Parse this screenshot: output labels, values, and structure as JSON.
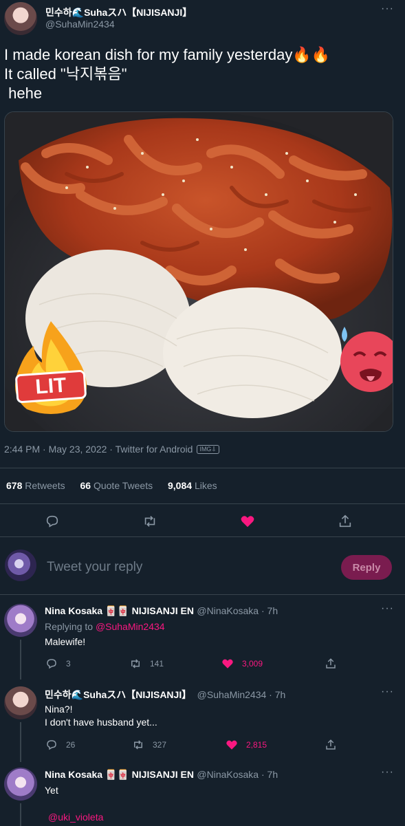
{
  "tweet": {
    "author_name": "민수하🌊Suhaスハ【NIJISANJI】",
    "author_handle": "@SuhaMin2434",
    "text_line1": "I made korean dish for my family yesterday🔥🔥",
    "text_line2": "It called \"낙지볶음\"",
    "text_line3": " hehe",
    "sticker_lit": "LIT",
    "timestamp": "2:44 PM · May 23, 2022 · Twitter for Android",
    "img_tag": "IMG⇩",
    "stats": {
      "retweets_count": "678",
      "retweets_label": "Retweets",
      "quotes_count": "66",
      "quotes_label": "Quote Tweets",
      "likes_count": "9,084",
      "likes_label": "Likes"
    }
  },
  "reply_box": {
    "placeholder": "Tweet your reply",
    "button_label": "Reply"
  },
  "replies": [
    {
      "name": "Nina Kosaka 🀄🀄 NIJISANJI EN",
      "handle": "@NinaKosaka · 7h",
      "replying_prefix": "Replying to ",
      "replying_handle": "@SuhaMin2434",
      "text": "Malewife!",
      "replies": "3",
      "retweets": "141",
      "likes": "3,009"
    },
    {
      "name": "민수하🌊Suhaスハ【NIJISANJI】",
      "handle": "@SuhaMin2434 · 7h",
      "text": "Nina?!\nI don't have husband yet...",
      "replies": "26",
      "retweets": "327",
      "likes": "2,815"
    },
    {
      "name": "Nina Kosaka 🀄🀄 NIJISANJI EN",
      "handle": "@NinaKosaka · 7h",
      "text": "Yet",
      "mention": "@uki_violeta"
    }
  ],
  "colors": {
    "background": "#15202b",
    "accent": "#f91880",
    "muted": "#8b98a5",
    "divider": "#38444d"
  },
  "icons": [
    "reply-icon",
    "retweet-icon",
    "heart-icon",
    "share-icon",
    "more-icon"
  ]
}
